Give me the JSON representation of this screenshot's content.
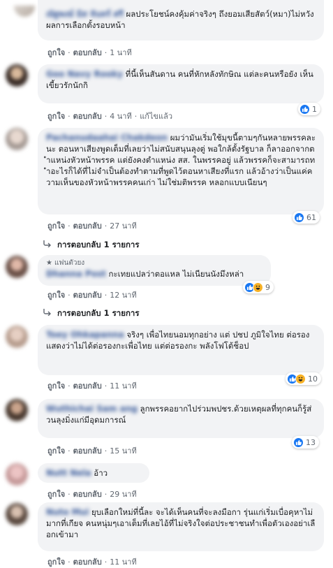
{
  "labels": {
    "like": "ถูกใจ",
    "reply": "ตอบกลับ",
    "edited": "แก้ไขแล้ว",
    "dot": "·"
  },
  "comments": [
    {
      "name": "ณัฐพงษ์ มิส จันทร์ ศรี",
      "text": "ผลประโยชน์คงคุ้มค่าจริงๆ ถึงยอมเสียสัตว์(หมา)ไม่หวังผลการเลือกตั้งรอบหน้า",
      "time": "1 นาที"
    },
    {
      "name": "Goo Navy Rooky",
      "text": "ที่นี้เห็นสันดาน คนที่หักหลังทักษิณ แต่ละคนหรือยัง เห็นเขี้ยวรักนักกิ",
      "time": "4 นาที",
      "edited": true,
      "reactions": {
        "count": "1",
        "icons": [
          "like"
        ]
      }
    },
    {
      "name": "Pachanudaahai Chakdeon",
      "text": "ผมว่ามันเริ่มใช้มุขนี้ตามๆกันหลายพรรคละนะ ตอนหาเสียงพูดเต็มที่เลยว่าไม่สนับสนุนลุงตู่ พอใกล้ตั้งรัฐบาล ก็ลาออกจากตำแหน่งหัวหน้าพรรค แต่ยังคงตำแหน่ง สส. ในพรรคอยู่ แล้วพรรคก็จะสามารถทำอะไรก็ได้ที่ไม่จำเป็นต้องทำตามที่พูดไว้ตอนหาเสียงที่แรก แล้วอ้างว่าเป็นแค่ความเห็นของหัวหน้าพรรคคนเก่า ไม่ใช่มติพรรค หลอกแบบเนียนๆ",
      "time": "27 นาที",
      "reactions": {
        "count": "61",
        "icons": [
          "like"
        ]
      },
      "replies": "การตอบกลับ 1 รายการ"
    },
    {
      "badge": "แฟนตัวยง",
      "name": "Dhanna Post",
      "text": "กะเทยแปลว่าตอแหล ไม่เนียนนังมึงหล่า",
      "time": "12 นาที",
      "reactions": {
        "count": "9",
        "icons": [
          "like",
          "haha"
        ]
      },
      "replies": "การตอบกลับ 1 รายการ"
    },
    {
      "name": "Toey Ohkapanna",
      "text": "จริงๆ เพื่อไทยนอมทุกอย่าง แต่ ปชป ภูมิใจไทย ต่อรอง แสดงว่าไม่ได้ต่อรองกะเพื่อไทย แต่ต่อรองกะ พลังโฟโต้ช็อป",
      "time": "11 นาที",
      "reactions": {
        "count": "10",
        "icons": [
          "like",
          "haha"
        ]
      }
    },
    {
      "name": "Wuthichai Sam ang",
      "text": "ลูกพรรคอยากไปร่วมพปชร.ด้วยเหตุผลที่ทุกคนก็รู้ส่วนลุงมิ่งแก่มีอุดมการณ์",
      "time": "15 นาที",
      "reactions": {
        "count": "13",
        "icons": [
          "like"
        ]
      }
    },
    {
      "name": "Nutt Nela",
      "text": "อ้าว",
      "time": "29 นาที"
    },
    {
      "name": "Nuto Mui",
      "text": "ยุบเลือกใหม่ที่นี้ละ จะได้เห็นคนที่จะลงมือกา รุ่นแก่เริ่มเบื่อคุหาไม่มากที่เกียจ คนหนุ่มๆเอาเต็มที่เลยไอ้ที่ไม่จริงใจต่อประชาชนทำเพื่อตัวเองอย่าเลือกเข้ามา",
      "time": "11 นาที"
    }
  ]
}
